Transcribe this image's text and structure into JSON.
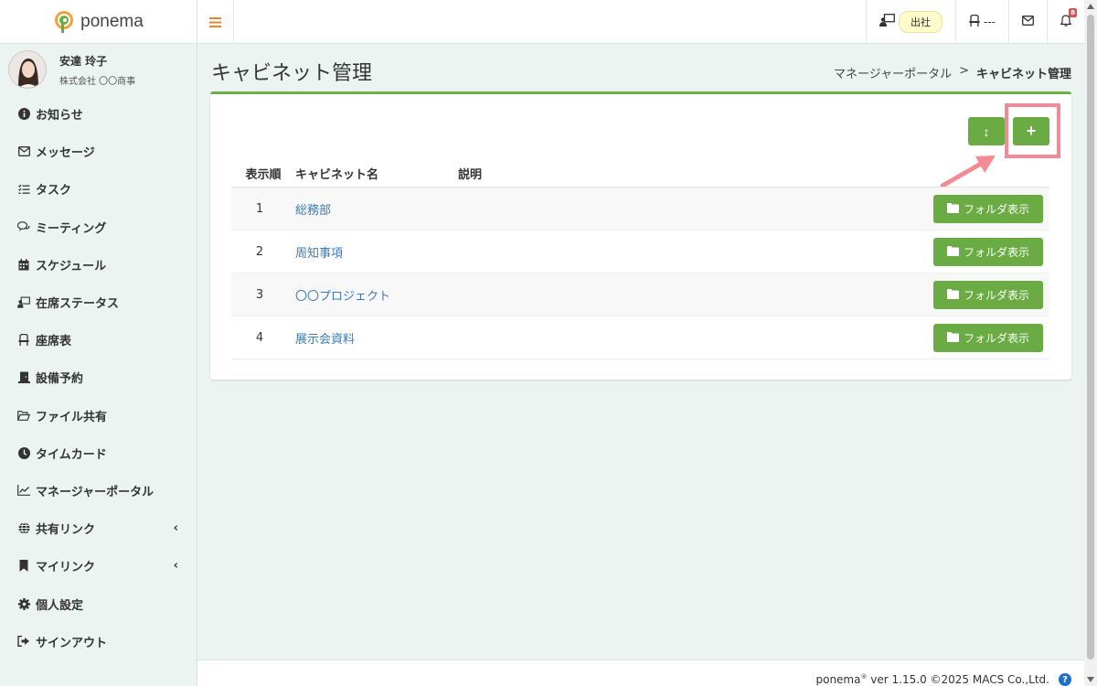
{
  "brand": {
    "name": "ponema",
    "accent": "#6aac43"
  },
  "user": {
    "name": "安達 玲子",
    "company": "株式会社 〇〇商事"
  },
  "sidebar": {
    "items": [
      {
        "label": "お知らせ",
        "icon": "info-icon"
      },
      {
        "label": "メッセージ",
        "icon": "envelope-icon"
      },
      {
        "label": "タスク",
        "icon": "tasks-icon"
      },
      {
        "label": "ミーティング",
        "icon": "chat-icon"
      },
      {
        "label": "スケジュール",
        "icon": "calendar-icon"
      },
      {
        "label": "在席ステータス",
        "icon": "presence-icon"
      },
      {
        "label": "座席表",
        "icon": "chair-icon"
      },
      {
        "label": "設備予約",
        "icon": "facility-icon"
      },
      {
        "label": "ファイル共有",
        "icon": "folder-open-icon"
      },
      {
        "label": "タイムカード",
        "icon": "clock-icon"
      },
      {
        "label": "マネージャーポータル",
        "icon": "chart-icon"
      },
      {
        "label": "共有リンク",
        "icon": "globe-icon",
        "chevron": "‹"
      },
      {
        "label": "マイリンク",
        "icon": "bookmark-icon",
        "chevron": "‹"
      },
      {
        "label": "個人設定",
        "icon": "gear-icon"
      },
      {
        "label": "サインアウト",
        "icon": "sign-out-icon"
      }
    ]
  },
  "topbar": {
    "status_label": "出社",
    "seat_label": "---",
    "notification_count": "8"
  },
  "page": {
    "title": "キャビネット管理"
  },
  "breadcrumb": {
    "parent": "マネージャーポータル",
    "separator": ">",
    "current": "キャビネット管理"
  },
  "table": {
    "headers": {
      "order": "表示順",
      "name": "キャビネット名",
      "description": "説明"
    },
    "rows": [
      {
        "order": "1",
        "name": "総務部",
        "description": "",
        "action": "フォルダ表示"
      },
      {
        "order": "2",
        "name": "周知事項",
        "description": "",
        "action": "フォルダ表示"
      },
      {
        "order": "3",
        "name": "〇〇プロジェクト",
        "description": "",
        "action": "フォルダ表示"
      },
      {
        "order": "4",
        "name": "展示会資料",
        "description": "",
        "action": "フォルダ表示"
      }
    ]
  },
  "buttons": {
    "sort_symbol": "↕",
    "add_symbol": "+"
  },
  "footer": {
    "brand": "ponema",
    "reg": "®",
    "version": " ver 1.15.0 ©2025 MACS Co.,Ltd.",
    "help": "?"
  }
}
